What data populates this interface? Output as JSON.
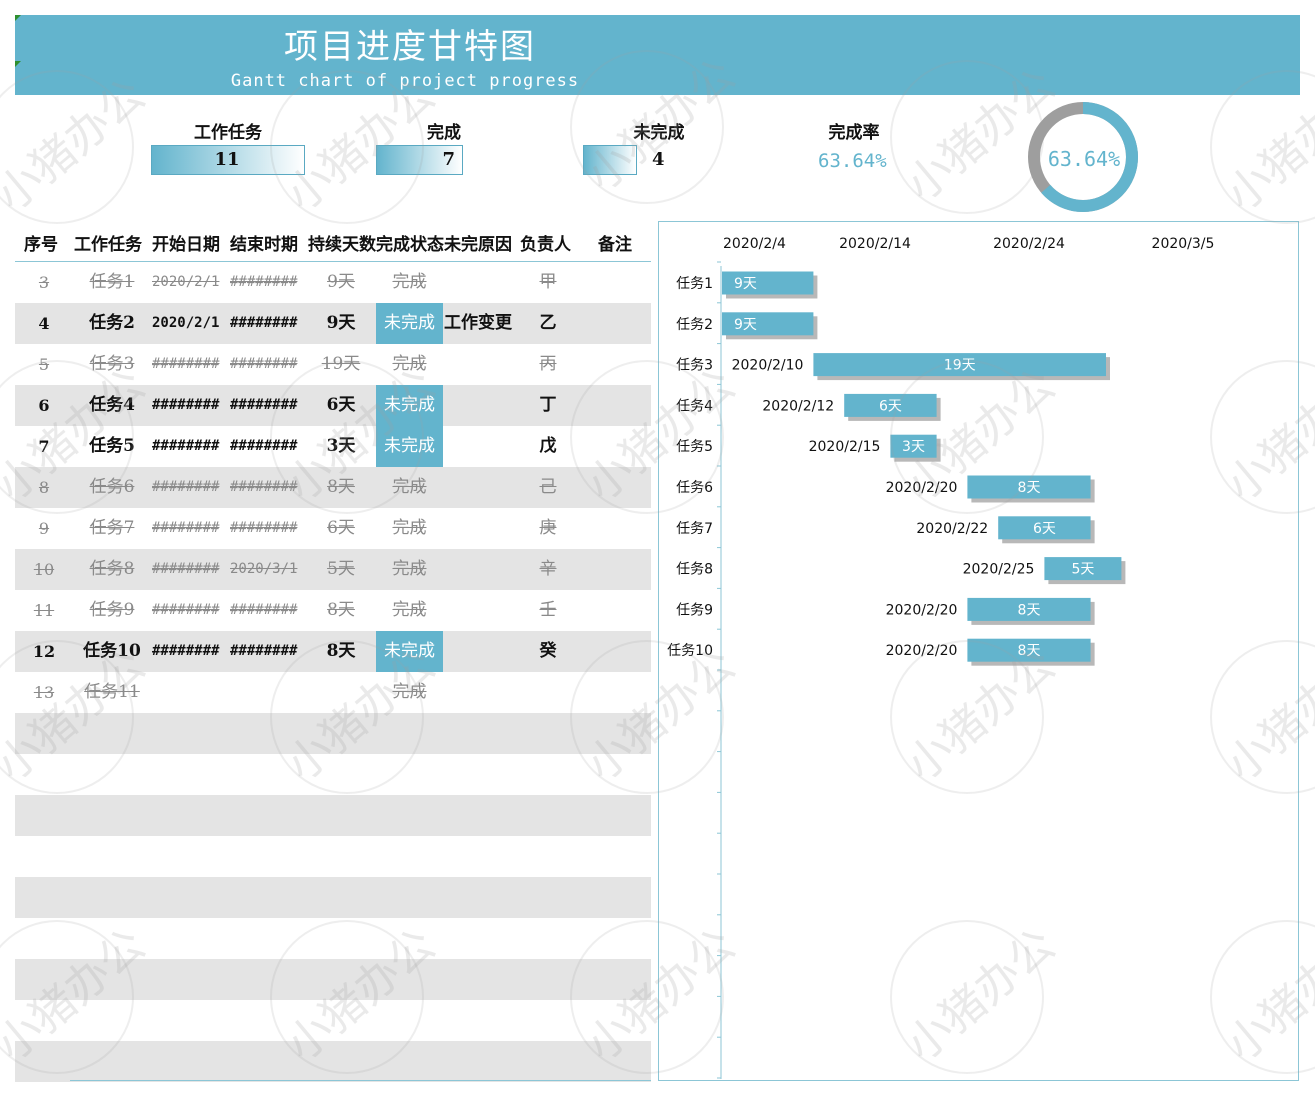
{
  "header": {
    "title": "项目进度甘特图",
    "subtitle": "Gantt chart of project progress"
  },
  "stats": {
    "tasks_label": "工作任务",
    "tasks_value": "11",
    "done_label": "完成",
    "done_value": "7",
    "todo_label": "未完成",
    "todo_value": "4",
    "rate_label": "完成率",
    "rate_value": "63.64%",
    "rate_fraction": 0.6364,
    "donut_text": "63.64%"
  },
  "colors": {
    "accent": "#63b4cd",
    "grey_band": "#e4e4e4",
    "donut_rest": "#9e9e9e"
  },
  "table": {
    "headers": [
      "序号",
      "工作任务",
      "开始日期",
      "结束时期",
      "持续天数",
      "完成状态",
      "未完原因",
      "负责人",
      "备注"
    ],
    "rows": [
      {
        "no": "3",
        "task": "任务1",
        "start": "2020/2/1",
        "end": "########",
        "days": "9天",
        "status": "完成",
        "reason": "",
        "owner": "甲",
        "note": "",
        "done": true
      },
      {
        "no": "4",
        "task": "任务2",
        "start": "2020/2/1",
        "end": "########",
        "days": "9天",
        "status": "未完成",
        "reason": "工作变更",
        "owner": "乙",
        "note": "",
        "done": false
      },
      {
        "no": "5",
        "task": "任务3",
        "start": "########",
        "end": "########",
        "days": "19天",
        "status": "完成",
        "reason": "",
        "owner": "丙",
        "note": "",
        "done": true
      },
      {
        "no": "6",
        "task": "任务4",
        "start": "########",
        "end": "########",
        "days": "6天",
        "status": "未完成",
        "reason": "",
        "owner": "丁",
        "note": "",
        "done": false
      },
      {
        "no": "7",
        "task": "任务5",
        "start": "########",
        "end": "########",
        "days": "3天",
        "status": "未完成",
        "reason": "",
        "owner": "戊",
        "note": "",
        "done": false
      },
      {
        "no": "8",
        "task": "任务6",
        "start": "########",
        "end": "########",
        "days": "8天",
        "status": "完成",
        "reason": "",
        "owner": "己",
        "note": "",
        "done": true
      },
      {
        "no": "9",
        "task": "任务7",
        "start": "########",
        "end": "########",
        "days": "6天",
        "status": "完成",
        "reason": "",
        "owner": "庚",
        "note": "",
        "done": true
      },
      {
        "no": "10",
        "task": "任务8",
        "start": "########",
        "end": "2020/3/1",
        "days": "5天",
        "status": "完成",
        "reason": "",
        "owner": "辛",
        "note": "",
        "done": true
      },
      {
        "no": "11",
        "task": "任务9",
        "start": "########",
        "end": "########",
        "days": "8天",
        "status": "完成",
        "reason": "",
        "owner": "壬",
        "note": "",
        "done": true
      },
      {
        "no": "12",
        "task": "任务10",
        "start": "########",
        "end": "########",
        "days": "8天",
        "status": "未完成",
        "reason": "",
        "owner": "癸",
        "note": "",
        "done": false
      },
      {
        "no": "13",
        "task": "任务11",
        "start": "",
        "end": "",
        "days": "",
        "status": "完成",
        "reason": "",
        "owner": "",
        "note": "",
        "done": true
      }
    ]
  },
  "chart_data": {
    "type": "bar",
    "orientation": "horizontal",
    "stacked": true,
    "x_axis_dates": [
      "2020/2/4",
      "2020/2/14",
      "2020/2/24",
      "2020/3/5"
    ],
    "x_range": [
      "2020/2/4",
      "2020/3/13"
    ],
    "grid": false,
    "tasks": [
      {
        "name": "任务1",
        "start": "2020/2/1",
        "start_label": "",
        "days": 9,
        "days_label": "9天"
      },
      {
        "name": "任务2",
        "start": "2020/2/1",
        "start_label": "",
        "days": 9,
        "days_label": "9天"
      },
      {
        "name": "任务3",
        "start": "2020/2/10",
        "start_label": "2020/2/10",
        "days": 19,
        "days_label": "19天"
      },
      {
        "name": "任务4",
        "start": "2020/2/12",
        "start_label": "2020/2/12",
        "days": 6,
        "days_label": "6天"
      },
      {
        "name": "任务5",
        "start": "2020/2/15",
        "start_label": "2020/2/15",
        "days": 3,
        "days_label": "3天"
      },
      {
        "name": "任务6",
        "start": "2020/2/20",
        "start_label": "2020/2/20",
        "days": 8,
        "days_label": "8天"
      },
      {
        "name": "任务7",
        "start": "2020/2/22",
        "start_label": "2020/2/22",
        "days": 6,
        "days_label": "6天"
      },
      {
        "name": "任务8",
        "start": "2020/2/25",
        "start_label": "2020/2/25",
        "days": 5,
        "days_label": "5天"
      },
      {
        "name": "任务9",
        "start": "2020/2/20",
        "start_label": "2020/2/20",
        "days": 8,
        "days_label": "8天"
      },
      {
        "name": "任务10",
        "start": "2020/2/20",
        "start_label": "2020/2/20",
        "days": 8,
        "days_label": "8天"
      }
    ]
  },
  "watermark": "小猪办公"
}
